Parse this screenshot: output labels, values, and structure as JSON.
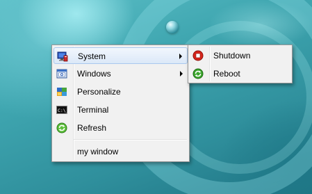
{
  "context_menu": {
    "items": [
      {
        "label": "System",
        "icon": "system-monitor-icon",
        "has_submenu": true,
        "highlighted": true
      },
      {
        "label": "Windows",
        "icon": "windows-icon",
        "has_submenu": true,
        "highlighted": false
      },
      {
        "label": "Personalize",
        "icon": "personalize-icon",
        "has_submenu": false,
        "highlighted": false
      },
      {
        "label": "Terminal",
        "icon": "terminal-icon",
        "has_submenu": false,
        "highlighted": false
      },
      {
        "label": "Refresh",
        "icon": "refresh-icon",
        "has_submenu": false,
        "highlighted": false
      },
      {
        "label": "my window",
        "icon": "",
        "has_submenu": false,
        "highlighted": false
      }
    ]
  },
  "system_submenu": {
    "items": [
      {
        "label": "Shutdown",
        "icon": "shutdown-icon"
      },
      {
        "label": "Reboot",
        "icon": "reboot-icon"
      }
    ]
  },
  "colors": {
    "menu_background": "#f1f1f1",
    "highlight_border": "#a9c8ee",
    "shutdown_red": "#d9261c",
    "reboot_green": "#3aa52c",
    "desktop_teal": "#3b98a4"
  }
}
